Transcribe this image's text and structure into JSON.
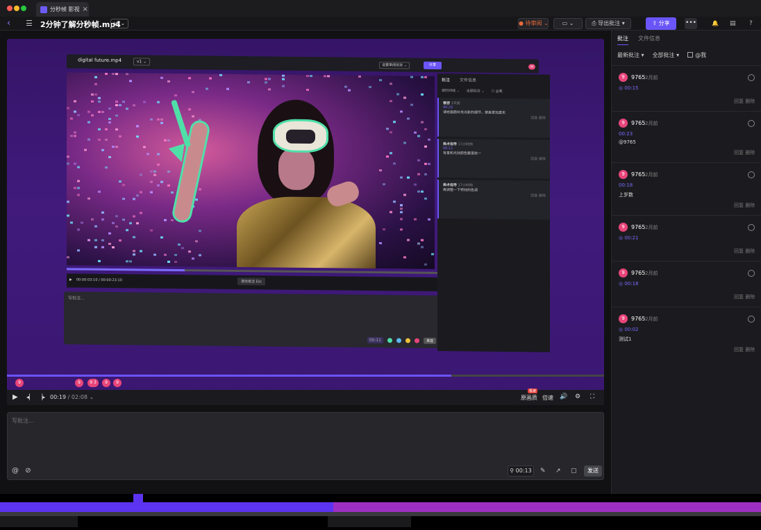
{
  "browser": {
    "tab_title": "分秒帧 影视",
    "close": "×",
    "dot_colors": [
      "#ff5f57",
      "#febc2e",
      "#28c840"
    ]
  },
  "toolbar": {
    "back": "‹",
    "title": "2分钟了解分秒帧.mp4",
    "version": "v2⌄",
    "status_select": "● 待审阅 ⌄",
    "view_btn": "▭ ⌄",
    "export_btn": "⎙ 导出批注 ▾",
    "share": "⇪ 分享",
    "more": "•••",
    "bell": "🔔",
    "box": "▤",
    "help": "?"
  },
  "inner": {
    "title": "digital future.mp4",
    "version": "v1 ⌄",
    "status": "设置审阅状态 ⌄",
    "share": "分享",
    "badge": "99",
    "time": "00:00:03:10 / 00:00:23:10",
    "exit": "退出批注 Esc",
    "placeholder": "写批注...",
    "send": "发送",
    "stamp": "00:11",
    "tabs": [
      "批注",
      "文件信息"
    ],
    "filters": [
      "按时间线 ⌄",
      "全部批注 ⌄",
      "☐ @我"
    ],
    "cards": [
      {
        "user": "春游",
        "time": "1天前",
        "ts": "00:25",
        "text": "请给画面补充光影的细节，使其更加真实",
        "acts": "回复 删除"
      },
      {
        "user": "美术指导",
        "time": "17小时前",
        "ts": "00:11",
        "text": "背景和光效颜色要更统一",
        "acts": "回复 删除"
      },
      {
        "user": "美术指导",
        "time": "17小时前",
        "ts": "",
        "text": "再调整一下特效的色调",
        "acts": "回复 删除"
      }
    ]
  },
  "player": {
    "markers": [
      "9",
      "9",
      "9 3",
      "9",
      "9"
    ],
    "current": "00:19",
    "total": "/ 02:08 ⌄",
    "resolution": "原画质",
    "resolution_badge": "极速",
    "speed": "倍速",
    "progress_fraction": 0.744
  },
  "comment": {
    "placeholder": "写批注...",
    "time": "⚲ 00:13",
    "send": "发送",
    "at": "@",
    "attach": "⊘"
  },
  "sidebar": {
    "tabs": [
      "批注",
      "文件信息"
    ],
    "filter_latest": "最新批注 ▾",
    "filter_all": "全部批注 ▾",
    "filter_me": "@我",
    "cards": [
      {
        "avatar": "9",
        "user": "9765",
        "time": "2月前",
        "ts": "◎ 00:15",
        "body": "",
        "acts": "回复  删除"
      },
      {
        "avatar": "9",
        "user": "9765",
        "time": "2月前",
        "ts": "00:23",
        "body": "@9765",
        "acts": "回复  删除"
      },
      {
        "avatar": "9",
        "user": "9765",
        "time": "2月前",
        "ts": "00:18",
        "body": "上岁数",
        "acts": "回复  删除"
      },
      {
        "avatar": "9",
        "user": "9765",
        "time": "2月前",
        "ts": "◎ 00:21",
        "body": "",
        "acts": "回复  删除"
      },
      {
        "avatar": "9",
        "user": "9765",
        "time": "2月前",
        "ts": "◎ 00:18",
        "body": "",
        "acts": "回复  删除"
      },
      {
        "avatar": "9",
        "user": "9765",
        "time": "2月前",
        "ts": "◎ 00:02",
        "body": "测试1",
        "acts": "回复  删除"
      }
    ]
  },
  "colors": {
    "accent": "#6a55f8",
    "marker": "#e8457a",
    "annotation": "#4fe0a8"
  }
}
